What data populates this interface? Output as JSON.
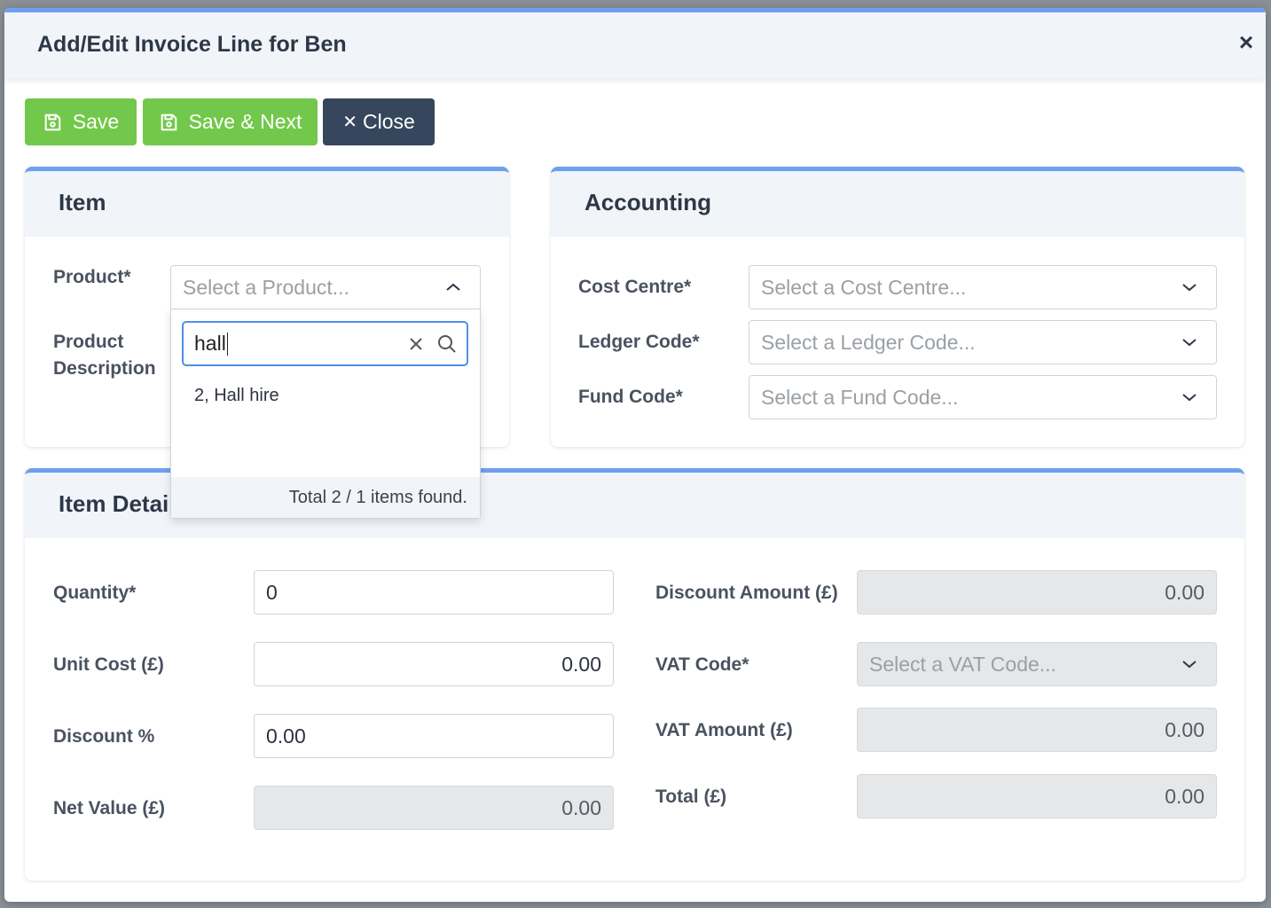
{
  "modal": {
    "title": "Add/Edit Invoice Line for Ben",
    "close_glyph": "×"
  },
  "toolbar": {
    "save_label": "Save",
    "save_next_label": "Save & Next",
    "close_label": "Close",
    "close_glyph": "✕"
  },
  "item_section": {
    "title": "Item",
    "product_label": "Product*",
    "product_placeholder": "Select a Product...",
    "product_description_label": "Product Description"
  },
  "product_dropdown": {
    "search_value": "hall",
    "options": [
      "2, Hall hire"
    ],
    "footer": "Total 2 / 1 items found."
  },
  "accounting_section": {
    "title": "Accounting",
    "cost_centre_label": "Cost Centre*",
    "cost_centre_placeholder": "Select a Cost Centre...",
    "ledger_code_label": "Ledger Code*",
    "ledger_code_placeholder": "Select a Ledger Code...",
    "fund_code_label": "Fund Code*",
    "fund_code_placeholder": "Select a Fund Code..."
  },
  "details_section": {
    "title": "Item Detai",
    "quantity_label": "Quantity*",
    "quantity_value": "0",
    "unit_cost_label": "Unit Cost (£)",
    "unit_cost_value": "0.00",
    "discount_pct_label": "Discount %",
    "discount_pct_value": "0.00",
    "net_value_label": "Net Value (£)",
    "net_value_value": "0.00",
    "discount_amount_label": "Discount Amount (£)",
    "discount_amount_value": "0.00",
    "vat_code_label": "VAT Code*",
    "vat_code_placeholder": "Select a VAT Code...",
    "vat_amount_label": "VAT Amount (£)",
    "vat_amount_value": "0.00",
    "total_label": "Total (£)",
    "total_value": "0.00"
  },
  "colors": {
    "accent_blue": "#6f9ff0",
    "save_green": "#72c84a",
    "close_dark": "#36465c"
  },
  "icons": [
    "close-icon",
    "save-icon",
    "chevron-down-icon",
    "chevron-up-icon",
    "clear-icon",
    "search-icon"
  ]
}
